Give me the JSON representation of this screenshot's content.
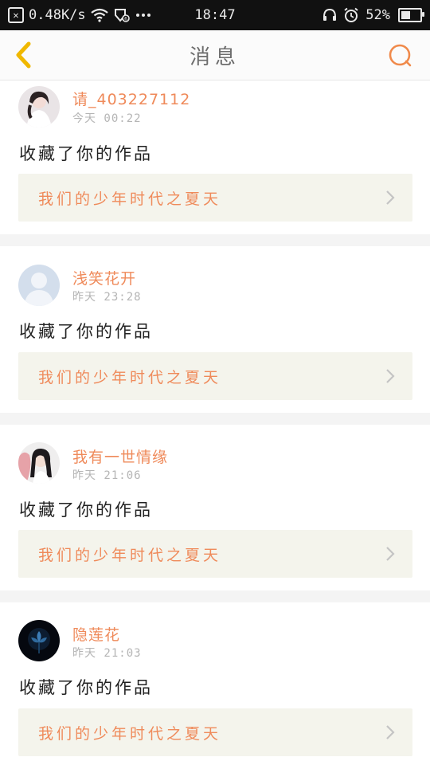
{
  "status_bar": {
    "net_speed": "0.48K/s",
    "time": "18:47",
    "battery": "52%",
    "battery_level": 0.52,
    "icons": [
      "close-box-icon",
      "wifi-icon",
      "notification-icon",
      "more-dots-icon",
      "headphones-icon",
      "alarm-icon",
      "battery-icon"
    ]
  },
  "header": {
    "title": "消息",
    "back_icon": "chevron-left-icon",
    "search_icon": "search-icon",
    "accent_color": "#f08a4b"
  },
  "messages": [
    {
      "username": "请_403227112",
      "time": "今天 00:22",
      "action": "收藏了你的作品",
      "work_title": "我们的少年时代之夏天",
      "avatar": "avatar-girl-photo"
    },
    {
      "username": "浅笑花开",
      "time": "昨天 23:28",
      "action": "收藏了你的作品",
      "work_title": "我们的少年时代之夏天",
      "avatar": "avatar-default"
    },
    {
      "username": "我有一世情缘",
      "time": "昨天 21:06",
      "action": "收藏了你的作品",
      "work_title": "我们的少年时代之夏天",
      "avatar": "avatar-girls-photo"
    },
    {
      "username": "隐莲花",
      "time": "昨天 21:03",
      "action": "收藏了你的作品",
      "work_title": "我们的少年时代之夏天",
      "avatar": "avatar-dark-flower"
    }
  ]
}
